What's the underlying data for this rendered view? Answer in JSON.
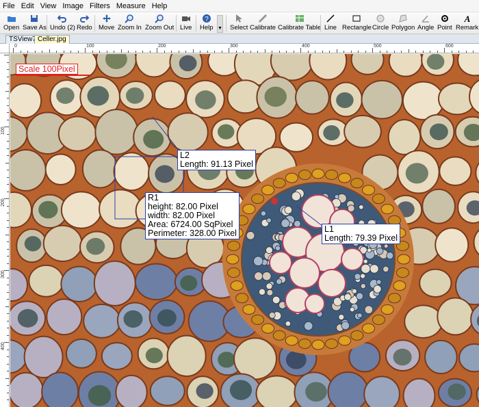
{
  "menu": [
    "File",
    "Edit",
    "View",
    "Image",
    "Filters",
    "Measure",
    "Help"
  ],
  "toolbar": {
    "open": "Open",
    "save_as": "Save As",
    "undo": "Undo (2)",
    "redo": "Redo",
    "move": "Move",
    "zoom_in": "Zoom In",
    "zoom_out": "Zoom Out",
    "live": "Live",
    "help": "Help",
    "select": "Select",
    "calibrate": "Calibrate",
    "calibrate_table": "Calibrate Table",
    "line": "Line",
    "rectangle": "Rectangle",
    "circle": "Circle",
    "polygon": "Polygon",
    "angle": "Angle",
    "point": "Point",
    "remark": "Remark"
  },
  "tabs": [
    "TSView7",
    "Celler.jpg"
  ],
  "ruler": {
    "h_labels": [
      "0",
      "100",
      "200",
      "300",
      "400",
      "500",
      "600"
    ],
    "v_labels": [
      "100",
      "200",
      "300",
      "400"
    ]
  },
  "scale_label": "Scale 100Pixel",
  "measurements": {
    "l2": {
      "name": "L2",
      "length": "Length:  91.13 Pixel"
    },
    "r1": {
      "name": "R1",
      "height": "height:  82.00 Pixel",
      "width": "width:  82.00 Pixel",
      "area": "Area:  6724.00 SqPixel",
      "perimeter": "Perimeter:  328.00 Pixel"
    },
    "l1": {
      "name": "L1",
      "length": "Length:  79.39 Pixel"
    }
  },
  "colors": {
    "measure_line": "#2b3fa8",
    "scale": "#e02020",
    "tissue_bg": "#c8703a"
  }
}
